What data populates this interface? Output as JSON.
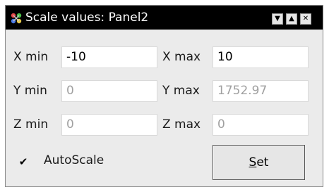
{
  "window": {
    "title": "Scale values: Panel2",
    "buttons": [
      "▼",
      "▲",
      "✕"
    ]
  },
  "x": {
    "min_label": "X min",
    "min_value": "-10",
    "max_label": "X max",
    "max_value": "10"
  },
  "y": {
    "min_label": "Y min",
    "min_value": "0",
    "max_label": "Y max",
    "max_value": "1752.97"
  },
  "z": {
    "min_label": "Z min",
    "min_value": "0",
    "max_label": "Z max",
    "max_value": "0"
  },
  "autoscale": {
    "label": "AutoScale",
    "checked": true,
    "mark": "✔"
  },
  "set_button": {
    "label_underlined": "S",
    "label_rest": "et"
  },
  "colors": {
    "titlebar": "#000000",
    "panel": "#ebebeb",
    "disabled_text": "#a0a0a0"
  }
}
